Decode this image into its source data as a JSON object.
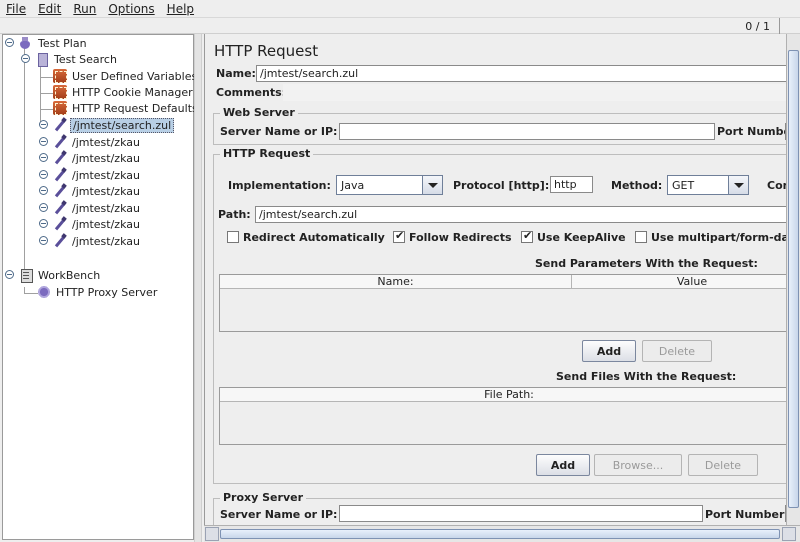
{
  "menu": [
    "File",
    "Edit",
    "Run",
    "Options",
    "Help"
  ],
  "counter": "0 / 1",
  "tree": {
    "items": [
      {
        "label": "Test Plan",
        "icon": "test-plan-icon"
      },
      {
        "label": "Test Search",
        "icon": "thread-group-icon"
      },
      {
        "label": "User Defined Variables",
        "icon": "config-element-icon"
      },
      {
        "label": "HTTP Cookie Manager",
        "icon": "config-element-icon"
      },
      {
        "label": "HTTP Request Defaults",
        "icon": "config-element-icon"
      },
      {
        "label": "/jmtest/search.zul",
        "icon": "sampler-icon",
        "selected": true
      },
      {
        "label": "/jmtest/zkau",
        "icon": "sampler-icon"
      },
      {
        "label": "/jmtest/zkau",
        "icon": "sampler-icon"
      },
      {
        "label": "/jmtest/zkau",
        "icon": "sampler-icon"
      },
      {
        "label": "/jmtest/zkau",
        "icon": "sampler-icon"
      },
      {
        "label": "/jmtest/zkau",
        "icon": "sampler-icon"
      },
      {
        "label": "/jmtest/zkau",
        "icon": "sampler-icon"
      },
      {
        "label": "/jmtest/zkau",
        "icon": "sampler-icon"
      },
      {
        "label": "WorkBench",
        "icon": "workbench-icon"
      },
      {
        "label": "HTTP Proxy Server",
        "icon": "proxy-server-icon"
      }
    ]
  },
  "form": {
    "title": "HTTP Request",
    "name_label": "Name:",
    "name_value": "/jmtest/search.zul",
    "comments_label": "Comments:",
    "web_server": {
      "group_title": "Web Server",
      "server_label": "Server Name or IP:",
      "server_value": "",
      "port_label": "Port Number"
    },
    "http_request": {
      "group_title": "HTTP Request",
      "implementation_label": "Implementation:",
      "implementation_value": "Java",
      "protocol_label": "Protocol [http]:",
      "protocol_value": "http",
      "method_label": "Method:",
      "method_value": "GET",
      "content_label": "Con",
      "path_label": "Path:",
      "path_value": "/jmtest/search.zul",
      "checkboxes": [
        {
          "label": "Redirect Automatically",
          "checked": false
        },
        {
          "label": "Follow Redirects",
          "checked": true
        },
        {
          "label": "Use KeepAlive",
          "checked": true
        },
        {
          "label": "Use multipart/form-dat",
          "checked": false
        }
      ],
      "params_title": "Send Parameters With the Request:",
      "params_columns": [
        "Name:",
        "Value"
      ],
      "add_label": "Add",
      "delete_label": "Delete",
      "files_title": "Send Files With the Request:",
      "files_columns": [
        "File Path:"
      ],
      "files_add_label": "Add",
      "browse_label": "Browse...",
      "files_delete_label": "Delete"
    },
    "proxy": {
      "group_title": "Proxy Server",
      "server_label": "Server Name or IP:",
      "server_value": "",
      "port_label": "Port Number:"
    }
  }
}
